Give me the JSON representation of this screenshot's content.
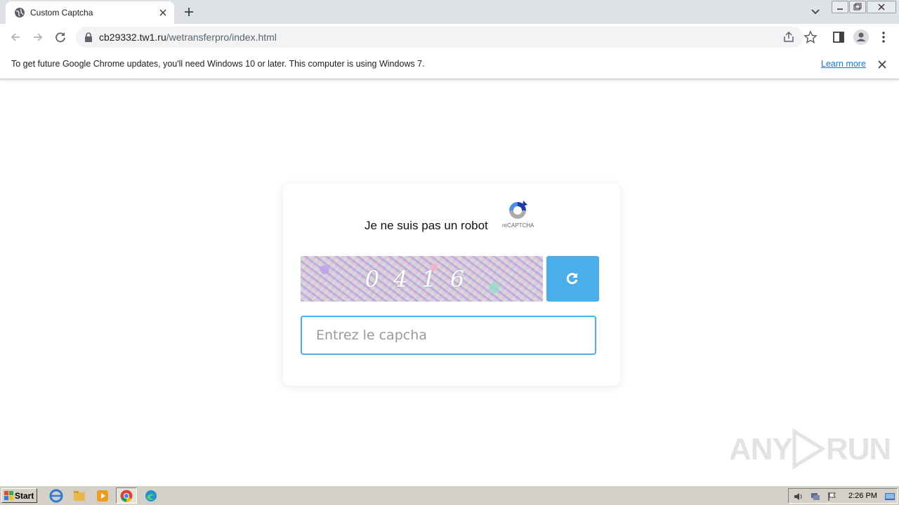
{
  "browser": {
    "tab_title": "Custom Captcha",
    "url_host": "cb29332.tw1.ru",
    "url_path": "/wetransferpro/index.html"
  },
  "infobar": {
    "message": "To get future Google Chrome updates, you'll need Windows 10 or later. This computer is using Windows 7.",
    "learn_more": "Learn more"
  },
  "captcha": {
    "robot_text": "Je ne suis pas un robot",
    "recaptcha_label": "reCAPTCHA",
    "code": "0416",
    "input_placeholder": "Entrez le capcha"
  },
  "watermark": {
    "left": "ANY",
    "right": "RUN"
  },
  "taskbar": {
    "start_label": "Start",
    "clock": "2:26 PM"
  },
  "colors": {
    "accent": "#4aaee8",
    "link": "#1a73e8"
  }
}
